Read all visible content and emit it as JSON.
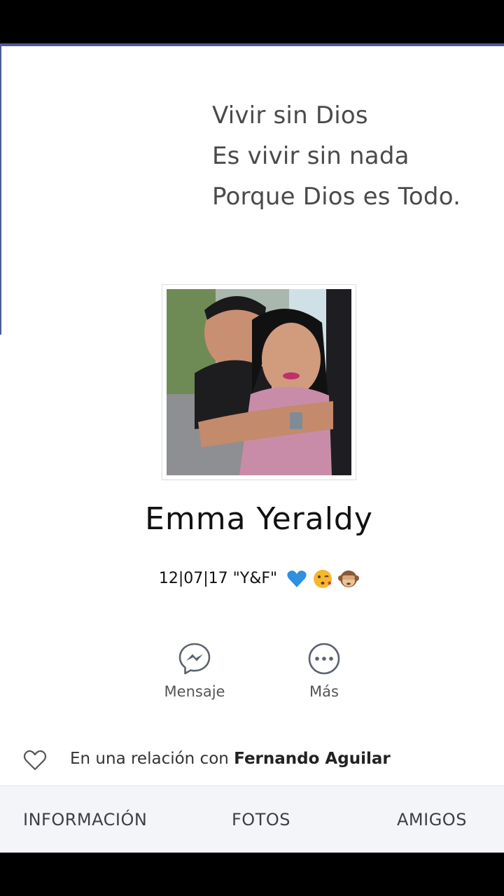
{
  "cover": {
    "quote_lines": [
      "Vivir sin Dios",
      "Es vivir sin nada",
      "Porque Dios es Todo."
    ]
  },
  "profile": {
    "name": "Emma Yeraldy",
    "bio_text": "12|07|17 \"Y&F\"",
    "bio_emojis": [
      "blue-heart-icon",
      "kissing-face-icon",
      "see-no-evil-monkey-icon"
    ]
  },
  "actions": {
    "message_label": "Mensaje",
    "more_label": "Más"
  },
  "relationship": {
    "prefix": "En una relación con",
    "partner": "Fernando Aguilar"
  },
  "tabs": {
    "info": "INFORMACIÓN",
    "photos": "FOTOS",
    "friends": "AMIGOS"
  },
  "colors": {
    "accent": "#4a5d96",
    "tabbar_bg": "#f4f5f8",
    "icon_stroke": "#5a6370"
  }
}
